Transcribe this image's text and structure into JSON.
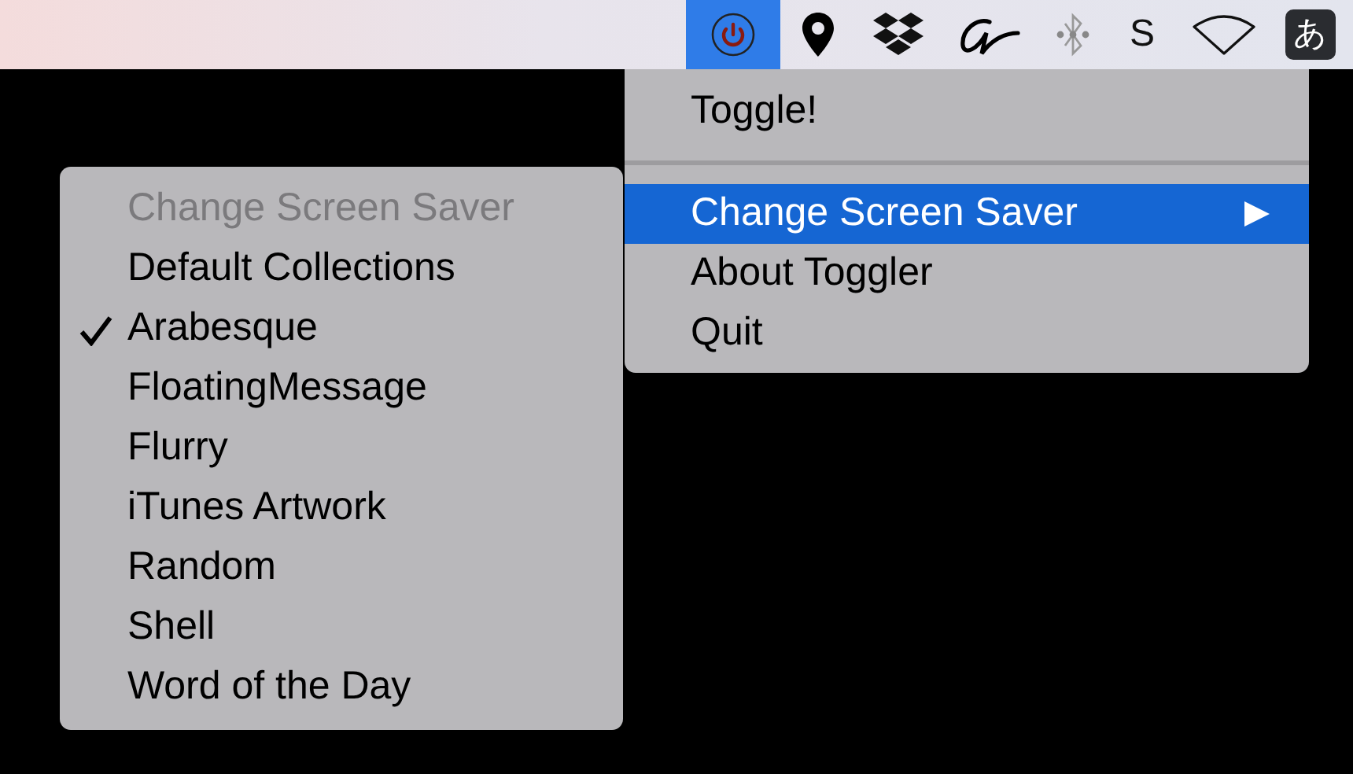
{
  "menu_bar": {
    "status_items": [
      {
        "kind": "power",
        "selected": true
      },
      {
        "kind": "pin",
        "selected": false
      },
      {
        "kind": "boxes",
        "selected": false
      },
      {
        "kind": "script",
        "selected": false
      },
      {
        "kind": "bluetooth",
        "selected": false
      },
      {
        "kind": "text",
        "text": "S",
        "selected": false
      },
      {
        "kind": "wifi",
        "selected": false
      },
      {
        "kind": "input",
        "text": "あ",
        "selected": false
      }
    ]
  },
  "menu": {
    "items": [
      {
        "kind": "item",
        "label": "Toggle!",
        "selected": false,
        "submenu": false
      },
      {
        "kind": "separator"
      },
      {
        "kind": "item",
        "label": "Change Screen Saver",
        "selected": true,
        "submenu": true
      },
      {
        "kind": "item",
        "label": "About Toggler",
        "selected": false,
        "submenu": false
      },
      {
        "kind": "item",
        "label": "Quit",
        "selected": false,
        "submenu": false
      }
    ]
  },
  "submenu": {
    "items": [
      {
        "label": "Change Screen Saver",
        "disabled": true,
        "checked": false
      },
      {
        "label": "Default Collections",
        "disabled": false,
        "checked": false
      },
      {
        "label": "Arabesque",
        "disabled": false,
        "checked": true
      },
      {
        "label": "FloatingMessage",
        "disabled": false,
        "checked": false
      },
      {
        "label": "Flurry",
        "disabled": false,
        "checked": false
      },
      {
        "label": "iTunes Artwork",
        "disabled": false,
        "checked": false
      },
      {
        "label": "Random",
        "disabled": false,
        "checked": false
      },
      {
        "label": "Shell",
        "disabled": false,
        "checked": false
      },
      {
        "label": "Word of the Day",
        "disabled": false,
        "checked": false
      }
    ]
  }
}
